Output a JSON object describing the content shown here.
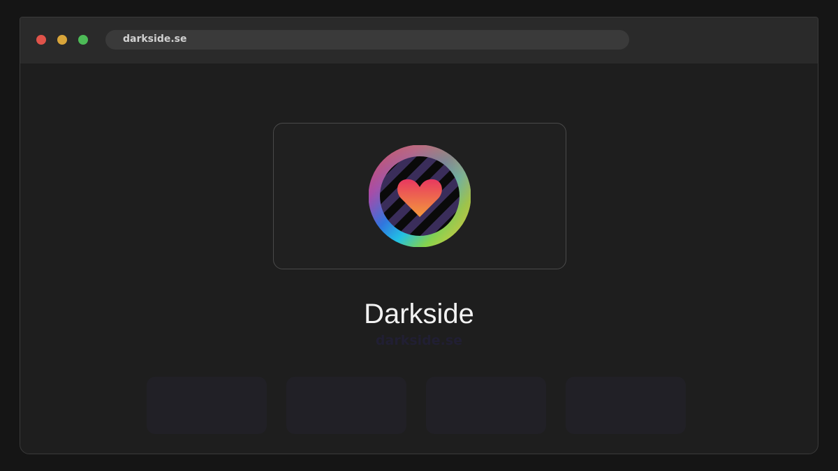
{
  "browser": {
    "address": "darkside.se"
  },
  "site": {
    "name": "Darkside",
    "domain": "darkside.se"
  },
  "icons": {
    "logo": "rainbow-ring-heart-logo",
    "window_controls": [
      "close-dot",
      "minimize-dot",
      "maximize-dot"
    ]
  },
  "colors": {
    "background": "#151515",
    "window": "#1e1e1e",
    "titlebar": "#2a2a2a",
    "address_bar": "#3a3a3a",
    "heart_top": "#e83860",
    "heart_bottom": "#f39a3c",
    "stripe": "#3a2d5a"
  }
}
